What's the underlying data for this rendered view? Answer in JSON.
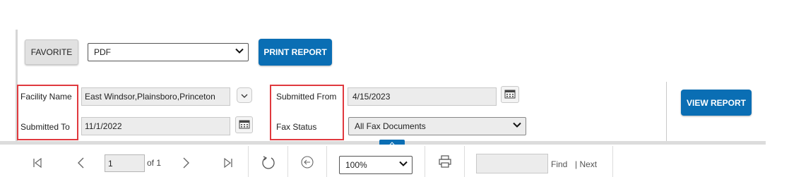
{
  "toolbar_top": {
    "favorite_label": "FAVORITE",
    "format_value": "PDF",
    "print_label": "PRINT REPORT"
  },
  "params": {
    "facility_name_label": "Facility Name",
    "facility_name_value": "East Windsor,Plainsboro,Princeton",
    "submitted_to_label": "Submitted To",
    "submitted_to_value": "11/1/2022",
    "submitted_from_label": "Submitted From",
    "submitted_from_value": "4/15/2023",
    "fax_status_label": "Fax Status",
    "fax_status_value": "All Fax Documents",
    "view_report_label": "VIEW REPORT"
  },
  "nav": {
    "page_value": "1",
    "page_of": "of 1",
    "zoom_value": "100%",
    "find_label": "Find",
    "next_label": "| Next"
  },
  "colors": {
    "accent": "#0a6eb4",
    "highlight": "#e0393e"
  }
}
